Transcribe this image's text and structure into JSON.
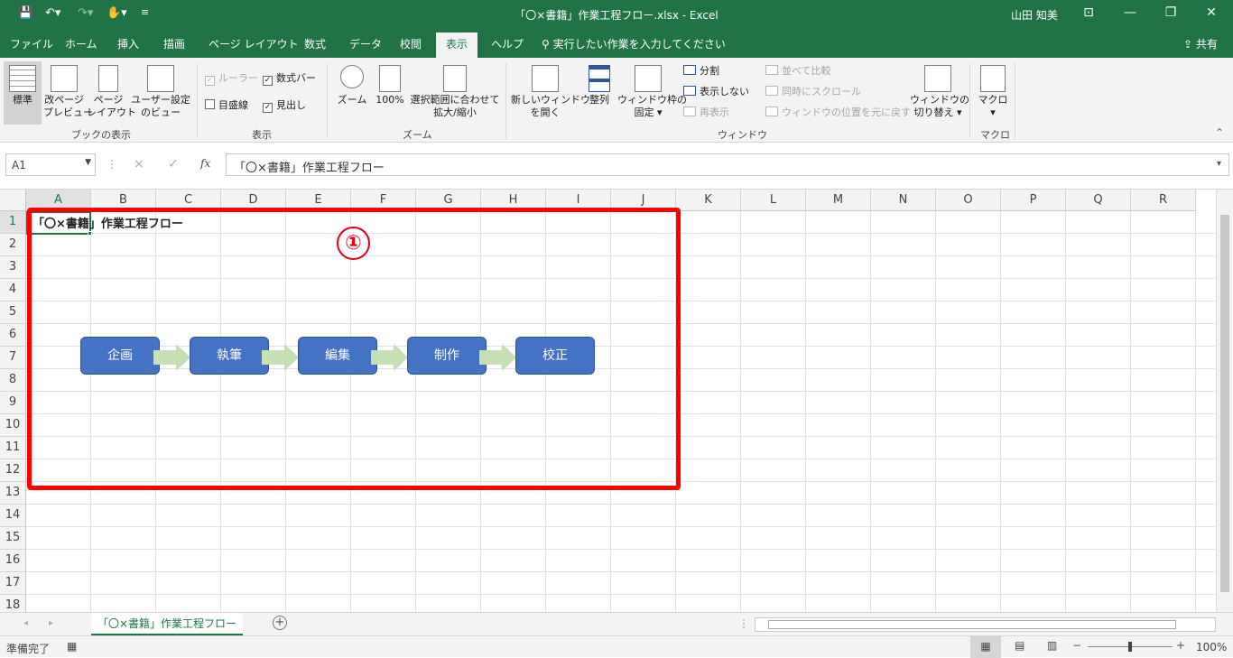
{
  "titlebar": {
    "title": "「〇×書籍」作業工程フロー.xlsx  -  Excel",
    "user": "山田 知美",
    "qa_save_icon": "save-icon",
    "qa_undo_icon": "undo-icon",
    "qa_redo_icon": "redo-icon",
    "qa_touch_icon": "touch-mode-icon",
    "qa_customize_icon": "customize-quick-access-icon"
  },
  "tabs": [
    "ファイル",
    "ホーム",
    "挿入",
    "描画",
    "ページ レイアウト",
    "数式",
    "データ",
    "校閲",
    "表示",
    "ヘルプ"
  ],
  "active_tab": "表示",
  "tell_me": "実行したい作業を入力してください",
  "share": "共有",
  "ribbon": {
    "book_views": {
      "normal": "標準",
      "page_break_1": "改ページ",
      "page_break_2": "プレビュー",
      "page_layout_1": "ページ",
      "page_layout_2": "レイアウト",
      "custom_1": "ユーザー設定",
      "custom_2": "のビュー",
      "label": "ブックの表示"
    },
    "show": {
      "ruler": "ルーラー",
      "formula_bar": "数式バー",
      "gridlines": "目盛線",
      "headings": "見出し",
      "label": "表示"
    },
    "zoom": {
      "zoom": "ズーム",
      "hundred": "100%",
      "fit_1": "選択範囲に合わせて",
      "fit_2": "拡大/縮小",
      "label": "ズーム"
    },
    "window": {
      "new_1": "新しいウィンドウ",
      "new_2": "を開く",
      "arrange": "整列",
      "freeze_1": "ウィンドウ枠の",
      "freeze_2": "固定",
      "split": "分割",
      "hide": "表示しない",
      "unhide": "再表示",
      "side_by_side": "並べて比較",
      "sync_scroll": "同時にスクロール",
      "reset_position": "ウィンドウの位置を元に戻す",
      "switch_1": "ウィンドウの",
      "switch_2": "切り替え",
      "label": "ウィンドウ"
    },
    "macros": {
      "macro": "マクロ",
      "label": "マクロ"
    }
  },
  "formula_bar": {
    "name_box": "A1",
    "cancel": "×",
    "enter": "✓",
    "fx": "fx",
    "content": "「〇×書籍」作業工程フロー"
  },
  "columns": [
    "A",
    "B",
    "C",
    "D",
    "E",
    "F",
    "G",
    "H",
    "I",
    "J",
    "K",
    "L",
    "M",
    "N",
    "O",
    "P",
    "Q",
    "R"
  ],
  "rows": [
    "1",
    "2",
    "3",
    "4",
    "5",
    "6",
    "7",
    "8",
    "9",
    "10",
    "11",
    "12",
    "13",
    "14",
    "15",
    "16",
    "17",
    "18"
  ],
  "cell_a1": "「〇×書籍」作業工程フロー",
  "callout": "①",
  "flow_steps": [
    "企画",
    "執筆",
    "編集",
    "制作",
    "校正"
  ],
  "colors": {
    "excel_green": "#217346",
    "shape_fill": "#4472c4",
    "arrow_fill": "#c5e0b4",
    "highlight_red": "#ff0000"
  },
  "sheet_tab": "「〇×書籍」作業工程フロー",
  "status": {
    "ready": "準備完了",
    "zoom": "100%"
  }
}
